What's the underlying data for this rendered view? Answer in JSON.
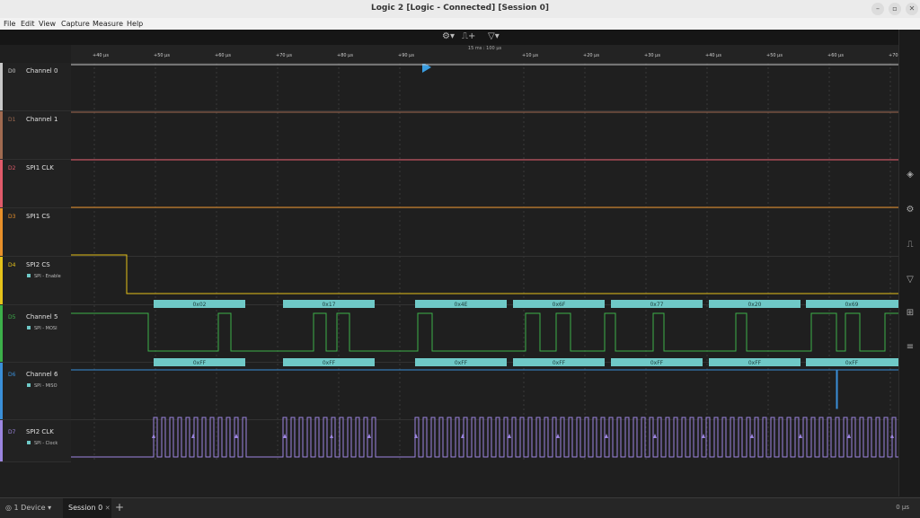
{
  "window": {
    "title": "Logic 2 [Logic - Connected] [Session 0]"
  },
  "menu": [
    "File",
    "Edit",
    "View",
    "Capture",
    "Measure",
    "Help"
  ],
  "toolbar": {
    "scale": "15 ms : 100 µs"
  },
  "ruler": {
    "ticks": [
      "+40 µs",
      "+50 µs",
      "+60 µs",
      "+70 µs",
      "+80 µs",
      "+90 µs",
      "+10 µs",
      "+20 µs",
      "+30 µs",
      "+40 µs",
      "+50 µs",
      "+60 µs",
      "+70"
    ]
  },
  "channels": [
    {
      "num": "D0",
      "name": "Channel 0",
      "color": "#c8c8c8",
      "analyzer": ""
    },
    {
      "num": "D1",
      "name": "Channel 1",
      "color": "#a06a50",
      "analyzer": ""
    },
    {
      "num": "D2",
      "name": "SPI1 CLK",
      "color": "#e05a6a",
      "analyzer": ""
    },
    {
      "num": "D3",
      "name": "SPI1 CS",
      "color": "#e8902a",
      "analyzer": ""
    },
    {
      "num": "D4",
      "name": "SPI2 CS",
      "color": "#e5c21a",
      "analyzer": "SPI - Enable"
    },
    {
      "num": "D5",
      "name": "Channel 5",
      "color": "#3cb04a",
      "analyzer": "SPI - MOSI"
    },
    {
      "num": "D6",
      "name": "Channel 6",
      "color": "#3a8fd8",
      "analyzer": "SPI - MISO"
    },
    {
      "num": "D7",
      "name": "SPI2 CLK",
      "color": "#9c85e0",
      "analyzer": "SPI - Clock"
    }
  ],
  "mosi_bytes": [
    "0x02",
    "0x17",
    "0x4E",
    "0x6F",
    "0x77",
    "0x20",
    "0x69"
  ],
  "miso_bytes": [
    "0xFF",
    "0xFF",
    "0xFF",
    "0xFF",
    "0xFF",
    "0xFF",
    "0xFF"
  ],
  "bottom": {
    "device": "1 Device",
    "session": "Session 0",
    "time": "0 µs"
  }
}
